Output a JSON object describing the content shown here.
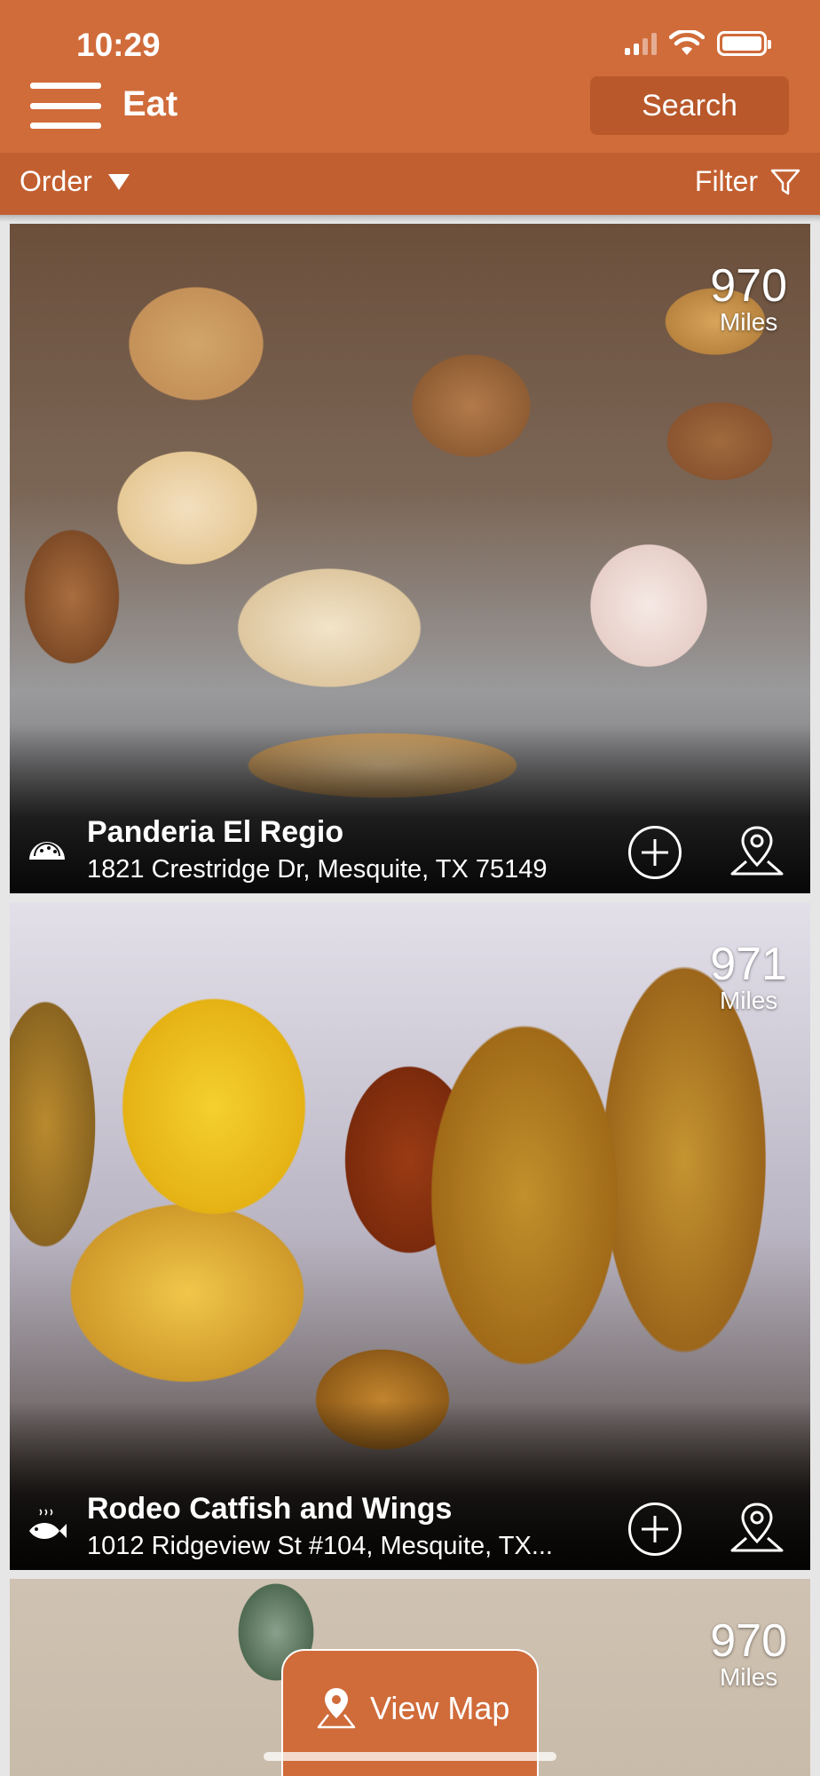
{
  "status_bar": {
    "time": "10:29"
  },
  "header": {
    "title": "Eat",
    "search_label": "Search"
  },
  "subbar": {
    "order_label": "Order",
    "filter_label": "Filter"
  },
  "listings": [
    {
      "name": "Panderia El Regio",
      "address": "1821 Crestridge Dr, Mesquite, TX 75149",
      "distance": "970",
      "distance_unit": "Miles",
      "category_icon": "taco-icon"
    },
    {
      "name": "Rodeo Catfish and Wings",
      "address": "1012 Ridgeview St #104, Mesquite, TX...",
      "distance": "971",
      "distance_unit": "Miles",
      "category_icon": "fish-icon"
    },
    {
      "distance": "970",
      "distance_unit": "Miles"
    }
  ],
  "view_map": {
    "label": "View Map"
  },
  "colors": {
    "brand": "#d06b3a",
    "brand_dark": "#c25f30",
    "button_dark": "#b8582b"
  }
}
